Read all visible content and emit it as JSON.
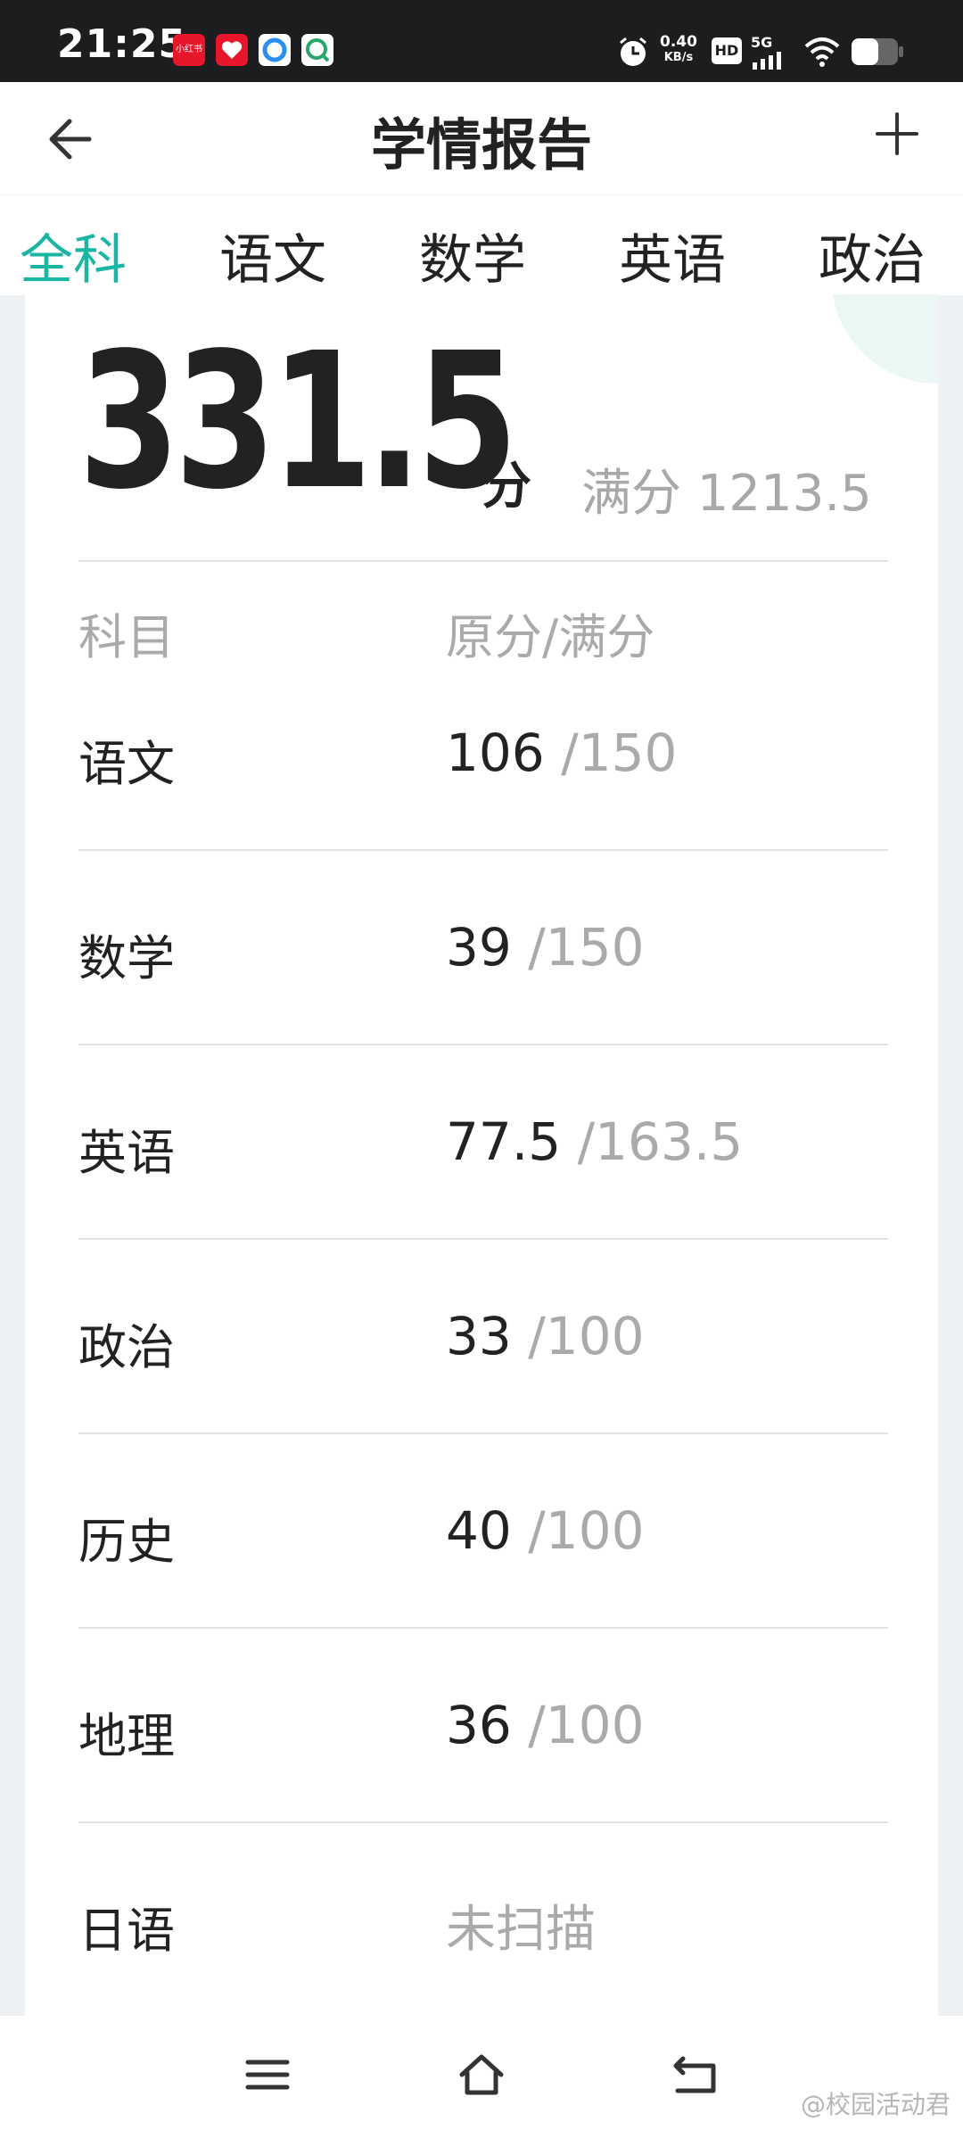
{
  "status_bar": {
    "time": "21:25",
    "net_speed_value": "0.40",
    "net_speed_unit": "KB/s",
    "app_icons": [
      "xiaohongshu-icon",
      "heart-app-icon",
      "browser-icon",
      "chat-app-icon"
    ],
    "indicators": [
      "alarm-icon",
      "hd-icon",
      "signal-5g-icon",
      "wifi-icon",
      "battery-icon"
    ],
    "hd_label": "HD",
    "net_label": "5G"
  },
  "header": {
    "title": "学情报告",
    "back_icon": "back-arrow-icon",
    "add_icon": "plus-icon"
  },
  "tabs": [
    {
      "label": "全科",
      "active": true
    },
    {
      "label": "语文",
      "active": false
    },
    {
      "label": "数学",
      "active": false
    },
    {
      "label": "英语",
      "active": false
    },
    {
      "label": "政治",
      "active": false
    }
  ],
  "summary": {
    "total_score": "331.5",
    "unit": "分",
    "full_score_label": "满分 1213.5"
  },
  "table": {
    "col_subject": "科目",
    "col_score": "原分/满分",
    "rows": [
      {
        "subject": "语文",
        "raw": "106",
        "max": "/150"
      },
      {
        "subject": "数学",
        "raw": "39",
        "max": "/150"
      },
      {
        "subject": "英语",
        "raw": "77.5",
        "max": "/163.5"
      },
      {
        "subject": "政治",
        "raw": "33",
        "max": "/100"
      },
      {
        "subject": "历史",
        "raw": "40",
        "max": "/100"
      },
      {
        "subject": "地理",
        "raw": "36",
        "max": "/100"
      },
      {
        "subject": "日语",
        "status": "未扫描"
      }
    ]
  },
  "nav": {
    "menu_icon": "menu-icon",
    "home_icon": "home-icon",
    "back_icon": "return-icon"
  },
  "watermark": "@校园活动君",
  "colors": {
    "accent": "#1bb5a4",
    "text": "#222222",
    "muted": "#aaaaaa"
  }
}
